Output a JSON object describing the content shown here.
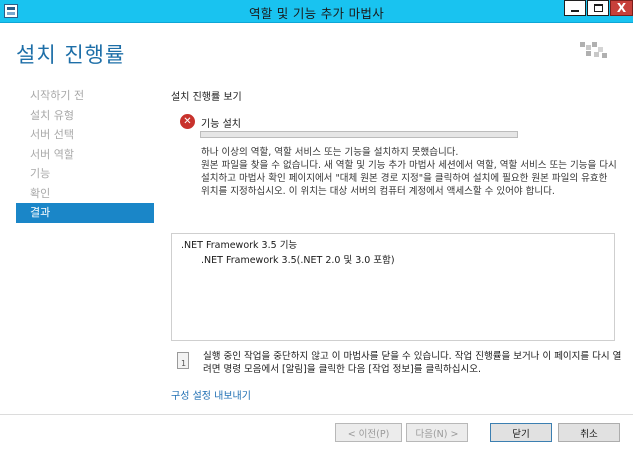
{
  "window": {
    "title": "역할 및 기능 추가 마법사",
    "controls": {
      "minimize": "minimize-icon",
      "maximize": "maximize-icon",
      "close": "X"
    }
  },
  "header": {
    "title": "설치 진행률",
    "server_icon": "server-icon"
  },
  "nav": {
    "items": [
      {
        "label": "시작하기 전",
        "active": false
      },
      {
        "label": "설치 유형",
        "active": false
      },
      {
        "label": "서버 선택",
        "active": false
      },
      {
        "label": "서버 역할",
        "active": false
      },
      {
        "label": "기능",
        "active": false
      },
      {
        "label": "확인",
        "active": false
      },
      {
        "label": "결과",
        "active": true
      }
    ]
  },
  "main": {
    "section_title": "설치 진행률 보기",
    "status_icon": "error-icon",
    "status_icon_glyph": "✕",
    "status_label": "기능 설치",
    "progress_percent": 0,
    "message": {
      "line1": "하나 이상의 역할, 역할 서비스 또는 기능을 설치하지 못했습니다.",
      "line2": "원본 파일을 찾을 수 없습니다. 새 역할 및 기능 추가 마법사 세션에서 역할, 역할 서비스 또는 기능을 다시 설치하고 마법사 확인 페이지에서 \"대체 원본 경로 지정\"을 클릭하여 설치에 필요한 원본 파일의 유효한 위치를 지정하십시오. 이 위치는 대상 서버의 컴퓨터 계정에서 액세스할 수 있어야 합니다."
    },
    "features": [
      {
        "label": ".NET Framework 3.5 기능",
        "level": 0
      },
      {
        "label": ".NET Framework 3.5(.NET 2.0 및 3.0 포함)",
        "level": 1
      }
    ],
    "note": "실행 중인 작업을 중단하지 않고 이 마법사를 닫을 수 있습니다. 작업 진행률을 보거나 이 페이지를 다시 열려면 명령 모음에서 [알림]을 클릭한 다음 [작업 정보]를 클릭하십시오.",
    "export_link": "구성 설정 내보내기"
  },
  "footer": {
    "prev": "< 이전(P)",
    "next": "다음(N) >",
    "close": "닫기",
    "cancel": "취소"
  },
  "colors": {
    "titlebar": "#19c3f0",
    "accent": "#1a86c8",
    "error": "#c8322c",
    "link": "#1f6fb3"
  }
}
